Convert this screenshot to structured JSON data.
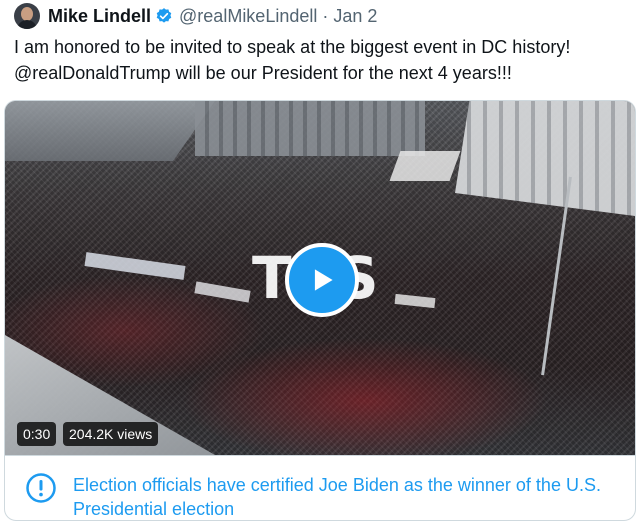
{
  "author": {
    "name": "Mike Lindell",
    "handle": "@realMikeLindell",
    "separator": "·",
    "date": "Jan 2"
  },
  "tweet": {
    "line1": "I am honored to be invited to speak at the biggest event in DC history!",
    "line2": "@realDonaldTrump will be our President for the next 4 years!!!"
  },
  "video": {
    "overlay_word": "TOS",
    "duration": "0:30",
    "views": "204.2K views"
  },
  "notice": {
    "text": "Election officials have certified Joe Biden as the winner of the U.S. Presidential election"
  },
  "colors": {
    "accent": "#1d9bf0",
    "text": "#0f1419",
    "muted": "#536471",
    "border": "#cfd9de"
  },
  "icons": [
    "verified-badge-icon",
    "play-icon",
    "exclamation-icon"
  ]
}
